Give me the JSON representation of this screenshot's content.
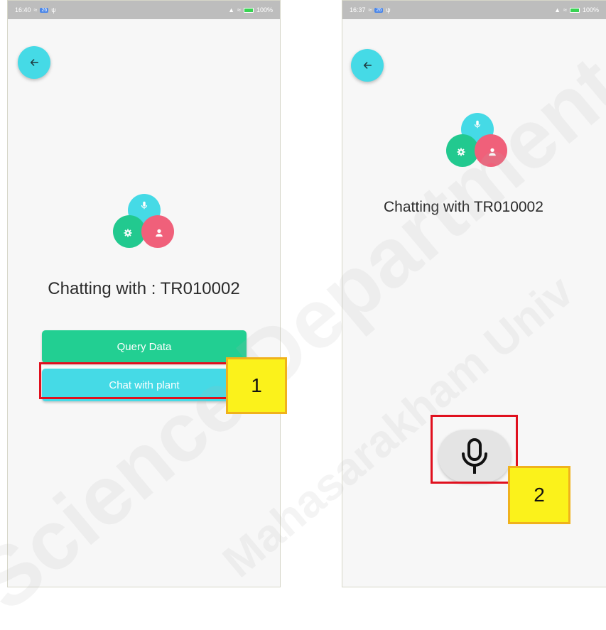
{
  "screen1": {
    "status": {
      "time": "16:40",
      "badge": "26",
      "battery": "100%"
    },
    "chat_title": "Chatting with : TR010002",
    "buttons": {
      "query": "Query Data",
      "chat": "Chat with plant"
    }
  },
  "screen2": {
    "status": {
      "time": "16:37",
      "badge": "26",
      "battery": "100%"
    },
    "chat_title": "Chatting with TR010002"
  },
  "callouts": {
    "one": "1",
    "two": "2"
  },
  "watermark": {
    "line1": "Science Department",
    "line2": "Mahasarakham Univ"
  },
  "icons": {
    "back": "arrow-left-icon",
    "mic": "microphone-icon",
    "gear": "gear-icon",
    "user": "person-icon"
  },
  "colors": {
    "cyan": "#45dae6",
    "green": "#22cf92",
    "pink": "#f0607a",
    "highlight": "#e0101e",
    "callout": "#fbf21b"
  }
}
